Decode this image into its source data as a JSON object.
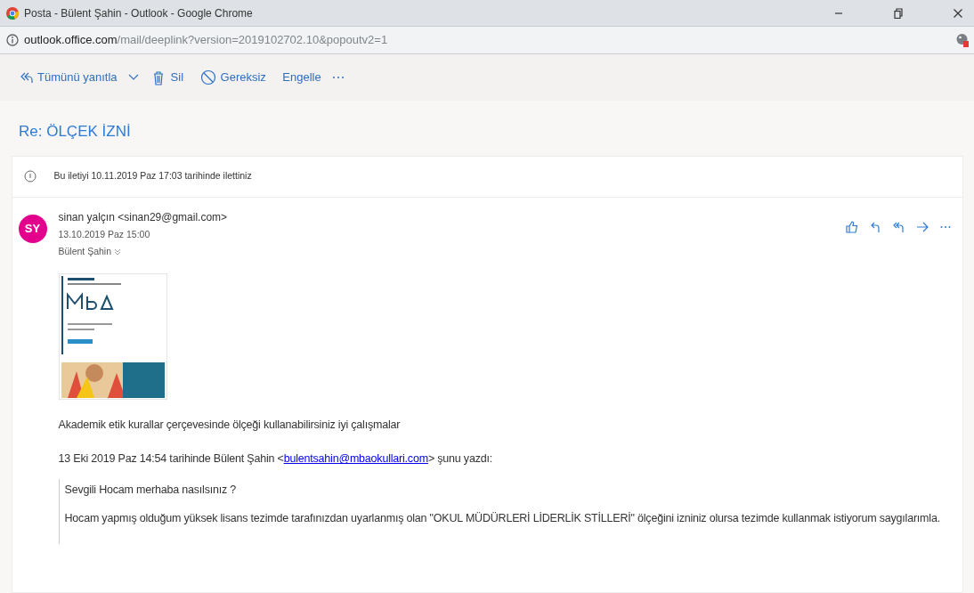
{
  "window": {
    "title": "Posta - Bülent Şahin - Outlook - Google Chrome"
  },
  "address_bar": {
    "host": "outlook.office.com",
    "path": "/mail/deeplink?version=2019102702.10&popoutv2=1"
  },
  "toolbar": [
    {
      "kind": "reply-all",
      "label": "Tümünü yanıtla"
    },
    {
      "kind": "delete",
      "label": "Sil"
    },
    {
      "kind": "junk",
      "label": "Gereksiz"
    },
    {
      "kind": "block",
      "label": "Engelle"
    },
    {
      "kind": "more"
    }
  ],
  "subject": "Re: ÖLÇEK İZNİ",
  "info_notice": "Bu iletiyi 10.11.2019 Paz 17:03 tarihinde ilettiniz",
  "message": {
    "avatar": "SY",
    "sender": "sinan yalçın <sinan29@gmail.com>",
    "date": "13.10.2019 Paz 15:00",
    "recipient": "Bülent Şahin",
    "body": "Akademik etik kurallar çerçevesinde ölçeği kullanabilirsiniz iyi çalışmalar",
    "attribution": {
      "before": "13 Eki 2019 Paz 14:54 tarihinde Bülent Şahin <",
      "link": "bulentsahin@mbaokullari.com",
      "after": "> şunu yazdı:"
    },
    "quote": [
      "Sevgili Hocam merhaba nasılsınız ?",
      "Hocam yapmış olduğum yüksek lisans tezimde tarafınızdan uyarlanmış olan \"OKUL MÜDÜRLERİ LİDERLİK STİLLERİ\" ölçeğini izniniz olursa tezimde kullanmak istiyorum saygılarımla."
    ]
  }
}
